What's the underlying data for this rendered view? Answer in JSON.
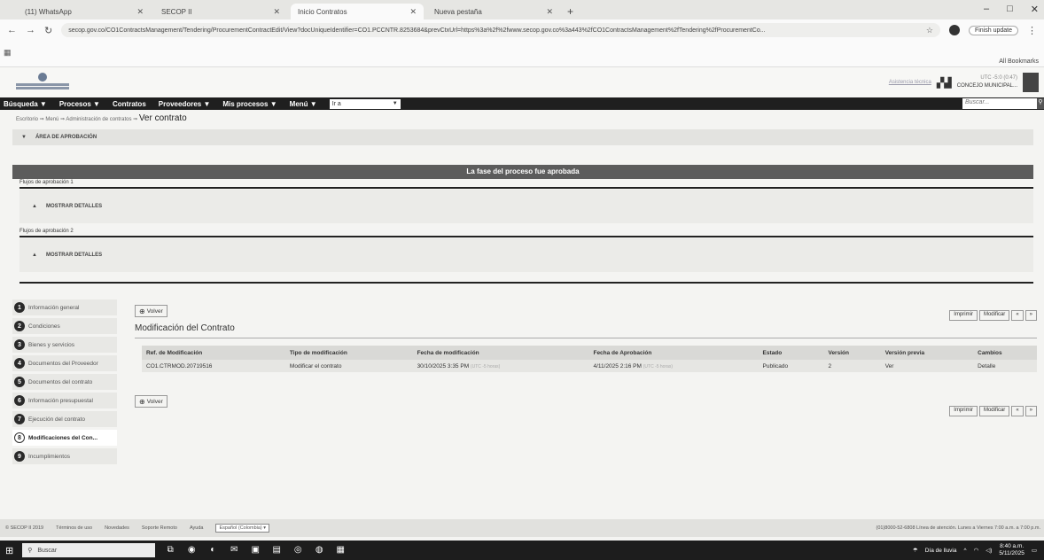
{
  "browser": {
    "tabs": [
      {
        "label": "(11) WhatsApp",
        "active": false
      },
      {
        "label": "SECOP II",
        "active": false
      },
      {
        "label": "Inicio Contratos",
        "active": true
      },
      {
        "label": "Nueva pestaña",
        "active": false
      }
    ],
    "url": "secop.gov.co/CO1ContractsManagement/Tendering/ProcurementContractEdit/View?docUniqueIdentifier=CO1.PCCNTR.8253684&prevCtxUrl=https%3a%2f%2fwww.secop.gov.co%3a443%2fCO1ContractsManagement%2fTendering%2fProcurementCo...",
    "finish_update": "Finish update",
    "all_bookmarks": "All Bookmarks"
  },
  "header": {
    "link": "Asistencia técnica",
    "user_tz": "UTC -5:0 (0:47)",
    "user_name": "CONCEJO MUNICIPAL..."
  },
  "nav": {
    "items": [
      "Búsqueda ▼",
      "Procesos ▼",
      "Contratos",
      "Proveedores ▼",
      "Mis procesos ▼",
      "Menú ▼"
    ],
    "goto": "Ir a",
    "search_placeholder": "Buscar..."
  },
  "breadcrumb": {
    "trail": "Escritorio ⇒ Menú ⇒ Administración de contratos ⇒",
    "current": "Ver contrato"
  },
  "approval": {
    "section_title": "ÁREA DE APROBACIÓN",
    "banner": "La fase del proceso fue aprobada",
    "flow1_label": "Flujos de aprobación 1",
    "flow2_label": "Flujos de aprobación 2",
    "show_details": "MOSTRAR DETALLES"
  },
  "steps": [
    {
      "num": "1",
      "label": "Información general",
      "active": false
    },
    {
      "num": "2",
      "label": "Condiciones",
      "active": false
    },
    {
      "num": "3",
      "label": "Bienes y servicios",
      "active": false
    },
    {
      "num": "4",
      "label": "Documentos del Proveedor",
      "active": false
    },
    {
      "num": "5",
      "label": "Documentos del contrato",
      "active": false
    },
    {
      "num": "6",
      "label": "Información presupuestal",
      "active": false
    },
    {
      "num": "7",
      "label": "Ejecución del contrato",
      "active": false
    },
    {
      "num": "8",
      "label": "Modificaciones del Con...",
      "active": true
    },
    {
      "num": "9",
      "label": "Incumplimientos",
      "active": false
    }
  ],
  "content": {
    "back_button": "Volver",
    "title": "Modificación del Contrato",
    "print_button": "Imprimir",
    "modify_button": "Modificar",
    "prev_button": "«",
    "next_button": "»",
    "columns": [
      "Ref. de Modificación",
      "Tipo de modificación",
      "Fecha de modificación",
      "Fecha de Aprobación",
      "Estado",
      "Versión",
      "Versión previa",
      "Cambios"
    ],
    "rows": [
      {
        "ref": "CO1.CTRMOD.20719516",
        "type": "Modificar el contrato",
        "mod_date": "30/10/2025 3:35 PM",
        "mod_tz": "(UTC -5 horas)",
        "approval_date": "4/11/2025 2:16 PM",
        "approval_tz": "(UTC -5 horas)",
        "status": "Publicado",
        "version": "2",
        "prev_version": "Ver",
        "changes": "Detalle"
      }
    ]
  },
  "footer": {
    "copyright": "© SECOP II 2019",
    "links": [
      "Términos de uso",
      "Novedades",
      "Soporte Remoto",
      "Ayuda"
    ],
    "language": "Español (Colombia) ▾",
    "contact": "(01)8000-52-6808 Línea de atención. Lunes a Viernes 7:00 a.m. a 7:00 p.m."
  },
  "taskbar": {
    "search": "Buscar",
    "weather": "Día de lluvia",
    "time": "8:40 a.m.",
    "date": "5/11/2025"
  }
}
